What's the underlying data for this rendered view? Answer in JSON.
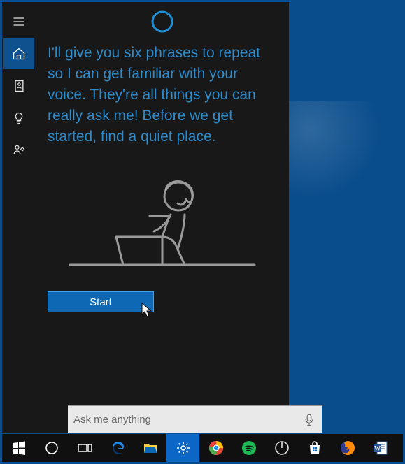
{
  "pane": {
    "message": "I'll give you six phrases to repeat so I can get familiar with your voice. They're all things you can really ask me! Before we get started, find a quiet place.",
    "start_label": "Start"
  },
  "search": {
    "placeholder": "Ask me anything"
  },
  "colors": {
    "accent": "#0e68b3",
    "text_link": "#2e8bcc",
    "pane_bg": "#181818",
    "desktop_bg": "#0a4d8c"
  },
  "nav": {
    "items": [
      "menu",
      "home",
      "notebook",
      "tips",
      "feedback"
    ],
    "active": "home"
  },
  "taskbar": {
    "items": [
      "start",
      "cortana",
      "task-view",
      "edge",
      "file-explorer",
      "settings",
      "chrome",
      "spotify",
      "power",
      "store",
      "firefox",
      "word"
    ]
  }
}
